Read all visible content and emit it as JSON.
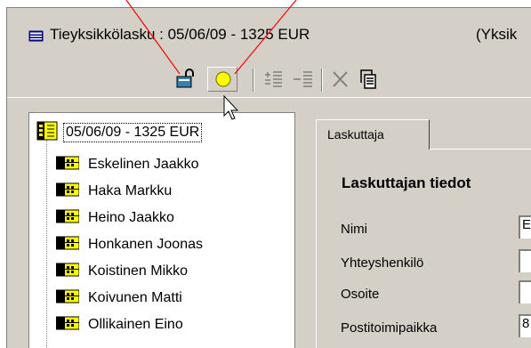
{
  "window": {
    "title": "Tieyksikkölasku : 05/06/09 - 1325 EUR",
    "title_extra": "(Yksik"
  },
  "toolbar": {
    "buttons": [
      {
        "icon": "lock-icon"
      },
      {
        "icon": "circle-icon"
      },
      {
        "icon": "insert-rows-icon"
      },
      {
        "icon": "remove-rows-icon"
      },
      {
        "icon": "delete-x-icon"
      },
      {
        "icon": "copy-document-icon"
      }
    ]
  },
  "tree": {
    "root": "05/06/09 - 1325 EUR",
    "items": [
      "Eskelinen Jaakko",
      "Haka Markku",
      "Heino Jaakko",
      "Honkanen Joonas",
      "Koistinen Mikko",
      "Koivunen Matti",
      "Ollikainen Eino"
    ]
  },
  "tabs": [
    "Laskuttaja"
  ],
  "section": {
    "title": "Laskuttajan tiedot",
    "fields": [
      {
        "label": "Nimi",
        "value": "E"
      },
      {
        "label": "Yhteyshenkilö",
        "value": ""
      },
      {
        "label": "Osoite",
        "value": ""
      },
      {
        "label": "Postitoimipaikka",
        "value": "8"
      }
    ]
  },
  "colors": {
    "annotation": "#ff0000",
    "window_bg": "#d4d0c8",
    "folder_yellow": "#ffff00"
  }
}
